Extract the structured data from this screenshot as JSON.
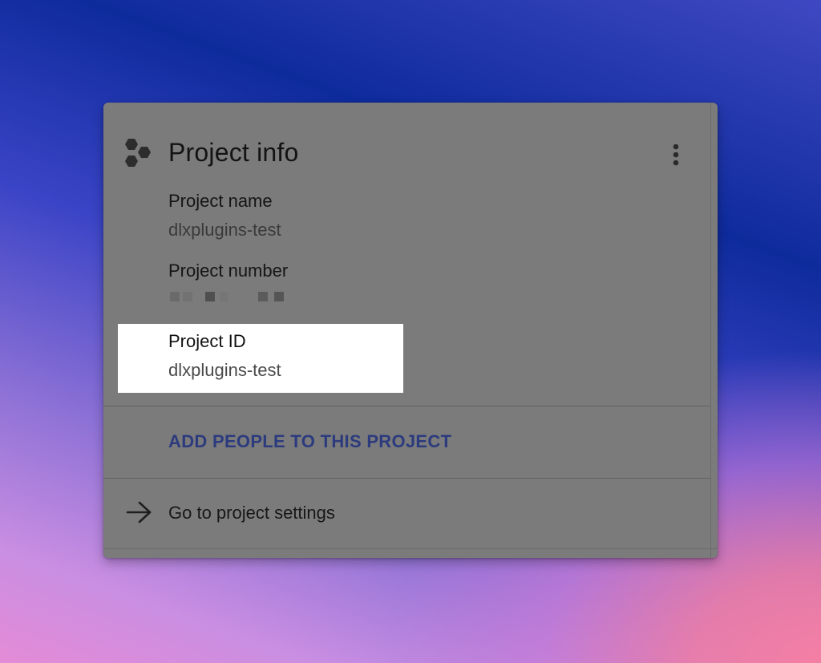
{
  "card": {
    "title": "Project info",
    "more_menu_icon": "more-vert-icon",
    "logo_icon": "hexagon-cluster-icon"
  },
  "project_name": {
    "label": "Project name",
    "value": "dlxplugins-test"
  },
  "project_number": {
    "label": "Project number",
    "value_redacted": true
  },
  "project_id": {
    "label": "Project ID",
    "value": "dlxplugins-test"
  },
  "actions": {
    "add_people_label": "ADD PEOPLE TO THIS PROJECT",
    "settings_label": "Go to project settings",
    "settings_icon": "arrow-right-icon"
  },
  "colors": {
    "card_background": "#7b7b7b",
    "link_color": "#2c3b7d",
    "highlight_background": "#ffffff"
  }
}
